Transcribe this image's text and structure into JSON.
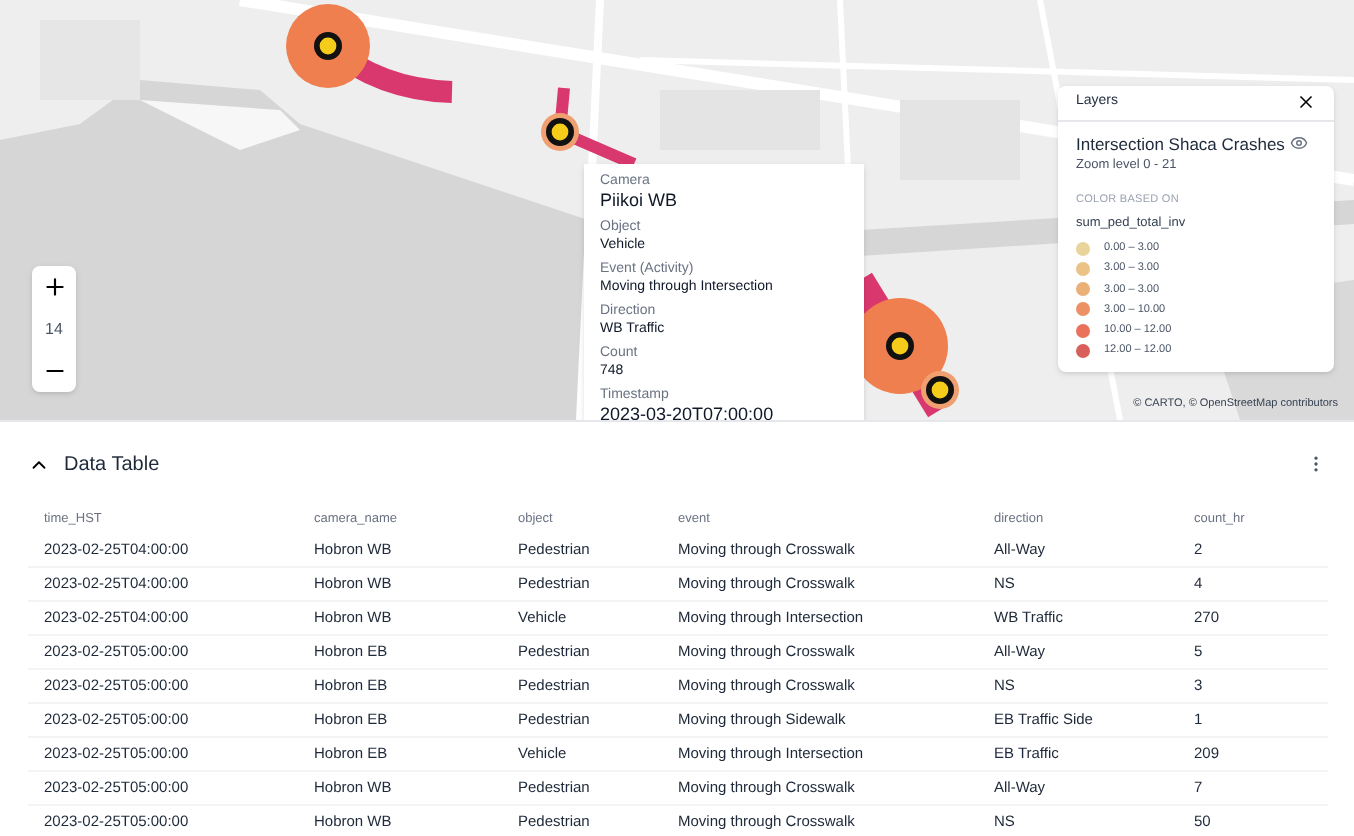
{
  "map": {
    "zoom_level": "14",
    "tooltip": {
      "fields": [
        {
          "label": "Camera",
          "value": "Piikoi WB",
          "kind": "title"
        },
        {
          "label": "Object",
          "value": "Vehicle",
          "kind": "field"
        },
        {
          "label": "Event (Activity)",
          "value": "Moving through Intersection",
          "kind": "field"
        },
        {
          "label": "Direction",
          "value": "WB Traffic",
          "kind": "field"
        },
        {
          "label": "Count",
          "value": "748",
          "kind": "field"
        },
        {
          "label": "Timestamp",
          "value": "2023-03-20T07:00:00",
          "kind": "title"
        }
      ]
    },
    "layers_panel": {
      "title": "Layers",
      "layer_name": "Intersection Shaca Crashes",
      "zoom_range": "Zoom level 0 - 21",
      "color_based_on": "COLOR BASED ON",
      "field": "sum_ped_total_inv",
      "legend": [
        {
          "label": "0.00 – 3.00",
          "color": "#e9d59b"
        },
        {
          "label": "3.00 – 3.00",
          "color": "#ecc387"
        },
        {
          "label": "3.00 – 3.00",
          "color": "#eab077"
        },
        {
          "label": "3.00 – 10.00",
          "color": "#ec9166"
        },
        {
          "label": "10.00 – 12.00",
          "color": "#ea725b"
        },
        {
          "label": "12.00 – 12.00",
          "color": "#d9605a"
        }
      ]
    },
    "attribution": "© CARTO, © OpenStreetMap contributors"
  },
  "data_table": {
    "title": "Data Table",
    "expanded": true,
    "columns": [
      "time_HST",
      "camera_name",
      "object",
      "event",
      "direction",
      "count_hr"
    ],
    "rows": [
      [
        "2023-02-25T04:00:00",
        "Hobron WB",
        "Pedestrian",
        "Moving through Crosswalk",
        "All-Way",
        "2"
      ],
      [
        "2023-02-25T04:00:00",
        "Hobron WB",
        "Pedestrian",
        "Moving through Crosswalk",
        "NS",
        "4"
      ],
      [
        "2023-02-25T04:00:00",
        "Hobron WB",
        "Vehicle",
        "Moving through Intersection",
        "WB Traffic",
        "270"
      ],
      [
        "2023-02-25T05:00:00",
        "Hobron EB",
        "Pedestrian",
        "Moving through Crosswalk",
        "All-Way",
        "5"
      ],
      [
        "2023-02-25T05:00:00",
        "Hobron EB",
        "Pedestrian",
        "Moving through Crosswalk",
        "NS",
        "3"
      ],
      [
        "2023-02-25T05:00:00",
        "Hobron EB",
        "Pedestrian",
        "Moving through Sidewalk",
        "EB Traffic Side",
        "1"
      ],
      [
        "2023-02-25T05:00:00",
        "Hobron EB",
        "Vehicle",
        "Moving through Intersection",
        "EB Traffic",
        "209"
      ],
      [
        "2023-02-25T05:00:00",
        "Hobron WB",
        "Pedestrian",
        "Moving through Crosswalk",
        "All-Way",
        "7"
      ],
      [
        "2023-02-25T05:00:00",
        "Hobron WB",
        "Pedestrian",
        "Moving through Crosswalk",
        "NS",
        "50"
      ]
    ]
  }
}
